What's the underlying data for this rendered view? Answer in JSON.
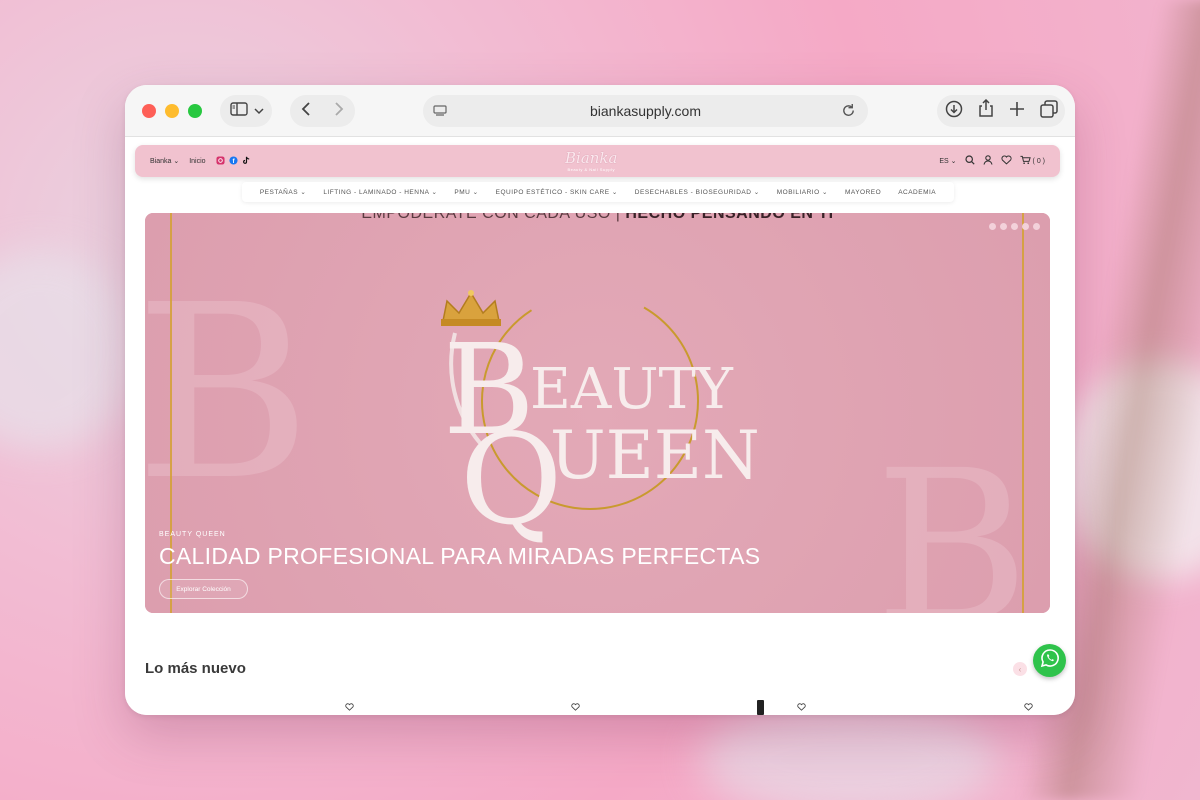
{
  "browser": {
    "url": "biankasupply.com"
  },
  "header": {
    "brand_menu": "Bianka",
    "home_link": "Inicio",
    "logo_text": "Bianka",
    "logo_subtext": "Beauty & Nail Supply",
    "language": "ES",
    "cart_count": "( 0 )"
  },
  "nav": {
    "items": [
      {
        "label": "PESTAÑAS"
      },
      {
        "label": "LIFTING - LAMINADO - HENNA"
      },
      {
        "label": "PMU"
      },
      {
        "label": "EQUIPO ESTÉTICO - SKIN CARE"
      },
      {
        "label": "DESECHABLES - BIOSEGURIDAD"
      },
      {
        "label": "MOBILIARIO"
      },
      {
        "label": "MAYOREO"
      },
      {
        "label": "ACADEMIA"
      }
    ]
  },
  "hero": {
    "tagline_part1": "EMPODERATE CON CADA USO |",
    "tagline_part2": "HECHO PENSANDO EN TI",
    "brand_line1": "EAUTY",
    "brand_line2": "UEEN",
    "kicker": "BEAUTY QUEEN",
    "title": "CALIDAD PROFESIONAL PARA MIRADAS PERFECTAS",
    "cta": "Explorar Colección"
  },
  "section": {
    "title": "Lo más nuevo"
  },
  "colors": {
    "header_bg": "#f1c2cf",
    "hero_bg": "#e1a5b4",
    "gold": "#d4a13a",
    "whatsapp": "#2fc34b"
  }
}
